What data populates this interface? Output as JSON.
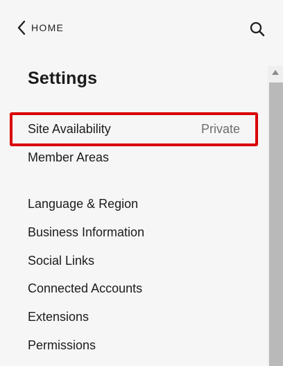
{
  "header": {
    "back_label": "HOME",
    "back_icon": "chevron-left-icon",
    "search_icon": "search-icon"
  },
  "page": {
    "title": "Settings"
  },
  "menu": {
    "site_availability": {
      "label": "Site Availability",
      "value": "Private"
    },
    "member_areas": {
      "label": "Member Areas"
    },
    "items": [
      {
        "label": "Language & Region"
      },
      {
        "label": "Business Information"
      },
      {
        "label": "Social Links"
      },
      {
        "label": "Connected Accounts"
      },
      {
        "label": "Extensions"
      },
      {
        "label": "Permissions"
      }
    ]
  },
  "colors": {
    "background": "#f6f6f6",
    "text": "#1b1b1b",
    "muted": "#6d6d6d",
    "highlight": "#d90000",
    "scrollbar_thumb": "#b9b9b9"
  }
}
